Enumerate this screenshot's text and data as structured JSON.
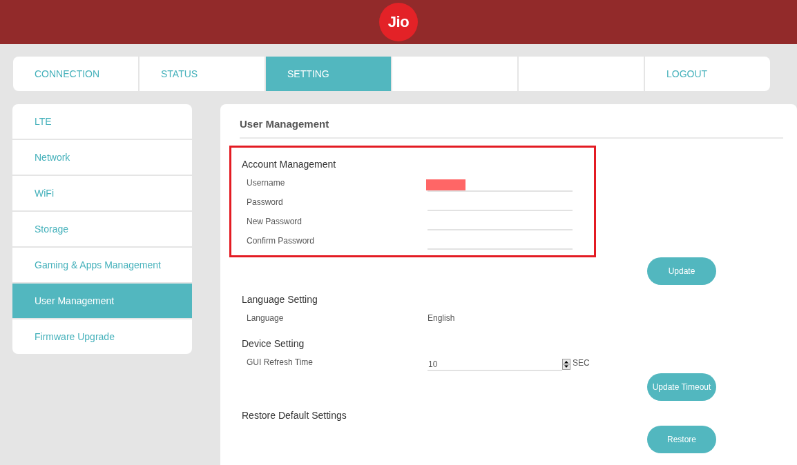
{
  "header": {
    "logo": "Jio"
  },
  "tabs": [
    {
      "label": "CONNECTION",
      "selected": false
    },
    {
      "label": "STATUS",
      "selected": false
    },
    {
      "label": "SETTING",
      "selected": true
    },
    {
      "selected": false
    },
    {
      "selected": false
    },
    {
      "label": "LOGOUT",
      "selected": false
    }
  ],
  "sidebar": {
    "items": [
      {
        "label": "LTE",
        "selected": false
      },
      {
        "label": "Network",
        "selected": false
      },
      {
        "label": "WiFi",
        "selected": false
      },
      {
        "label": "Storage",
        "selected": false
      },
      {
        "label": "Gaming & Apps Management",
        "selected": false
      },
      {
        "label": "User Management",
        "selected": true
      },
      {
        "label": "Firmware Upgrade",
        "selected": false
      }
    ]
  },
  "panel": {
    "title": "User Management",
    "sections": [
      {
        "title": "Account Management",
        "highlighted": true,
        "rows": [
          {
            "kind": "field",
            "label": "Username",
            "redacted": true
          },
          {
            "kind": "field",
            "label": "Password",
            "redacted": false
          },
          {
            "kind": "field",
            "label": "New Password",
            "redacted": false
          },
          {
            "kind": "field",
            "label": "Confirm Password",
            "redacted": false
          }
        ],
        "button": "Update"
      },
      {
        "title": "Language Setting",
        "rows": [
          {
            "kind": "text",
            "label": "Language",
            "value": "English"
          }
        ]
      },
      {
        "title": "Device Setting",
        "rows": [
          {
            "kind": "spinner",
            "label": "GUI Refresh Time",
            "value": "10",
            "unit": "SEC"
          }
        ],
        "button": "Update Timeout"
      },
      {
        "title": "Restore Default Settings",
        "button": "Restore"
      }
    ]
  }
}
